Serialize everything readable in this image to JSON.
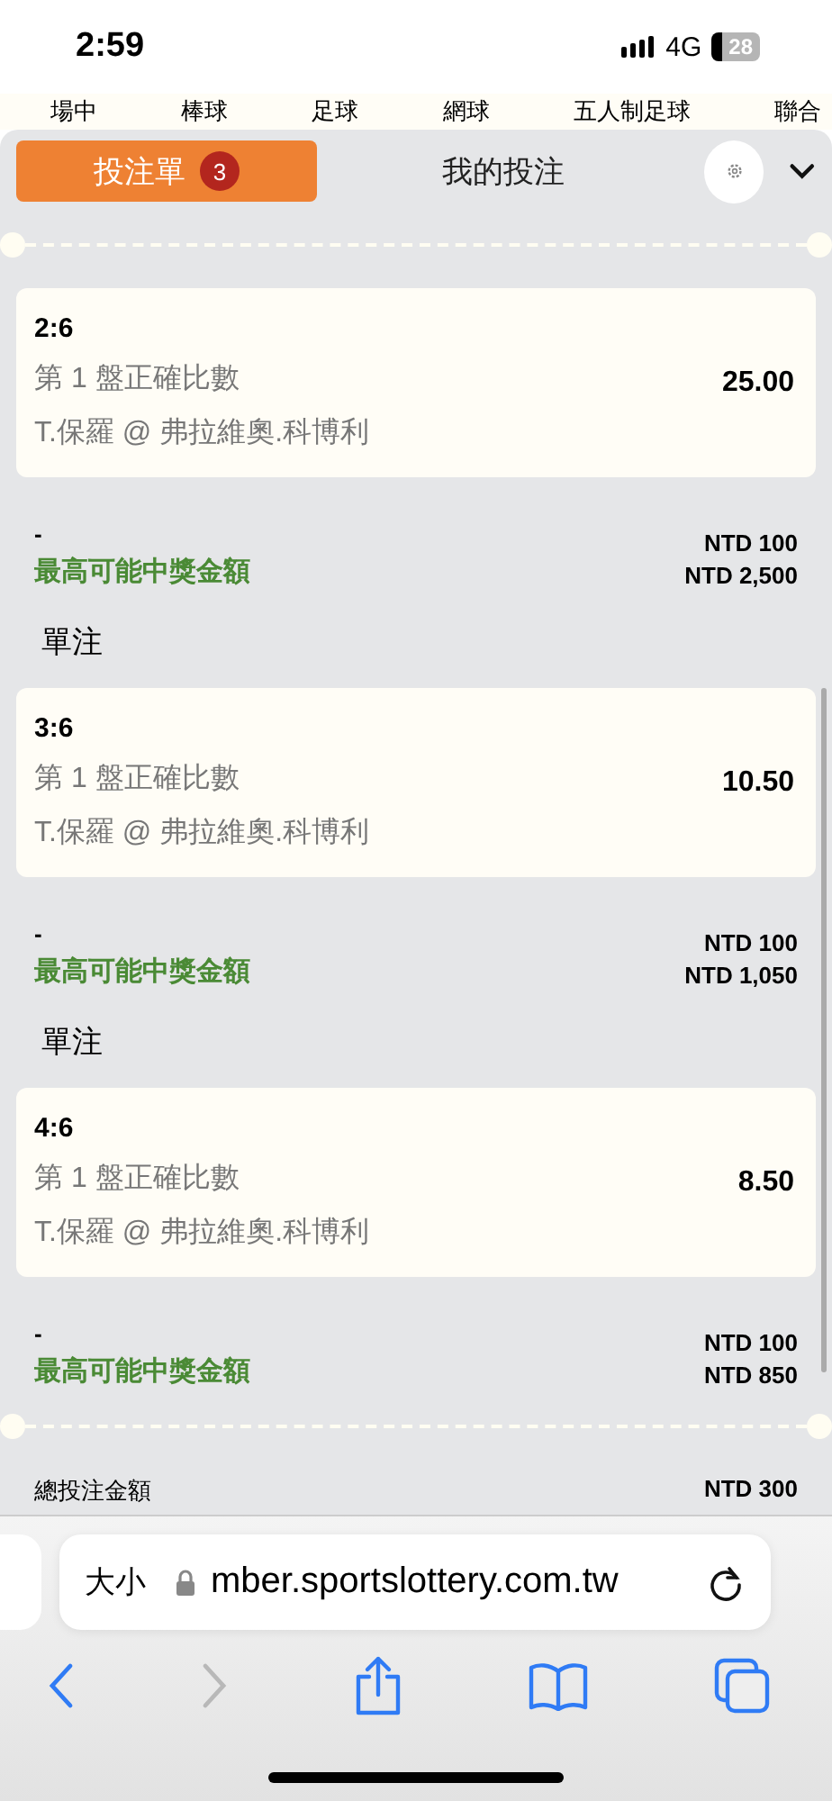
{
  "status_bar": {
    "time": "2:59",
    "network": "4G",
    "battery": "28"
  },
  "sports_tabs": [
    "場中",
    "棒球",
    "足球",
    "網球",
    "五人制足球",
    "聯合"
  ],
  "tabs": [
    {
      "label": "投注單",
      "badge": "3",
      "selected": true
    },
    {
      "label": "我的投注",
      "selected": false
    }
  ],
  "bets": [
    {
      "score": "2:6",
      "market": "第 1 盤正確比數",
      "match": "T.保羅 @ 弗拉維奧.科博利",
      "odds": "25.00",
      "dash": "-",
      "payout_label": "最高可能中獎金額",
      "stake": "NTD 100",
      "payout": "NTD 2,500"
    },
    {
      "section": "單注",
      "score": "3:6",
      "market": "第 1 盤正確比數",
      "match": "T.保羅 @ 弗拉維奧.科博利",
      "odds": "10.50",
      "dash": "-",
      "payout_label": "最高可能中獎金額",
      "stake": "NTD 100",
      "payout": "NTD 1,050"
    },
    {
      "section": "單注",
      "score": "4:6",
      "market": "第 1 盤正確比數",
      "match": "T.保羅 @ 弗拉維奧.科博利",
      "odds": "8.50",
      "dash": "-",
      "payout_label": "最高可能中獎金額",
      "stake": "NTD 100",
      "payout": "NTD 850"
    }
  ],
  "total": {
    "label": "總投注金額",
    "value": "NTD 300"
  },
  "browser": {
    "text_size": "大小",
    "url": "mber.sportslottery.com.tw",
    "forward_disabled": true
  }
}
